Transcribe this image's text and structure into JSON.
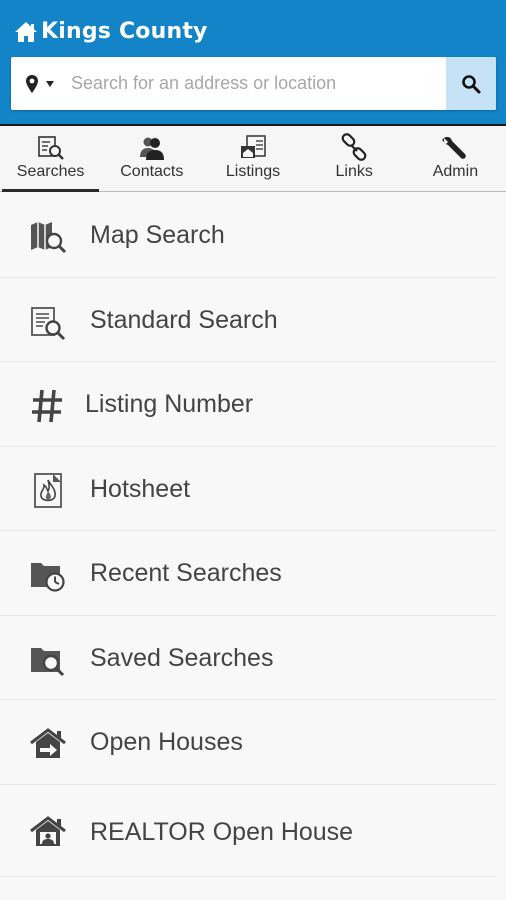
{
  "header": {
    "title": "Kings County",
    "background": "#1384c7"
  },
  "search": {
    "placeholder": "Search for an address or location",
    "button_color": "#c5e3f4"
  },
  "tabs": [
    {
      "label": "Searches",
      "icon": "search-document-icon",
      "active": true
    },
    {
      "label": "Contacts",
      "icon": "contacts-icon",
      "active": false
    },
    {
      "label": "Listings",
      "icon": "listings-icon",
      "active": false
    },
    {
      "label": "Links",
      "icon": "link-icon",
      "active": false
    },
    {
      "label": "Admin",
      "icon": "wrench-icon",
      "active": false
    }
  ],
  "menu": [
    {
      "label": "Map Search",
      "icon": "map-search-icon"
    },
    {
      "label": "Standard Search",
      "icon": "document-search-icon"
    },
    {
      "label": "Listing Number",
      "icon": "hash-icon"
    },
    {
      "label": "Hotsheet",
      "icon": "fire-document-icon"
    },
    {
      "label": "Recent Searches",
      "icon": "folder-clock-icon"
    },
    {
      "label": "Saved Searches",
      "icon": "folder-search-icon"
    },
    {
      "label": "Open Houses",
      "icon": "house-arrow-icon"
    },
    {
      "label": "REALTOR Open House",
      "icon": "house-person-icon"
    }
  ]
}
